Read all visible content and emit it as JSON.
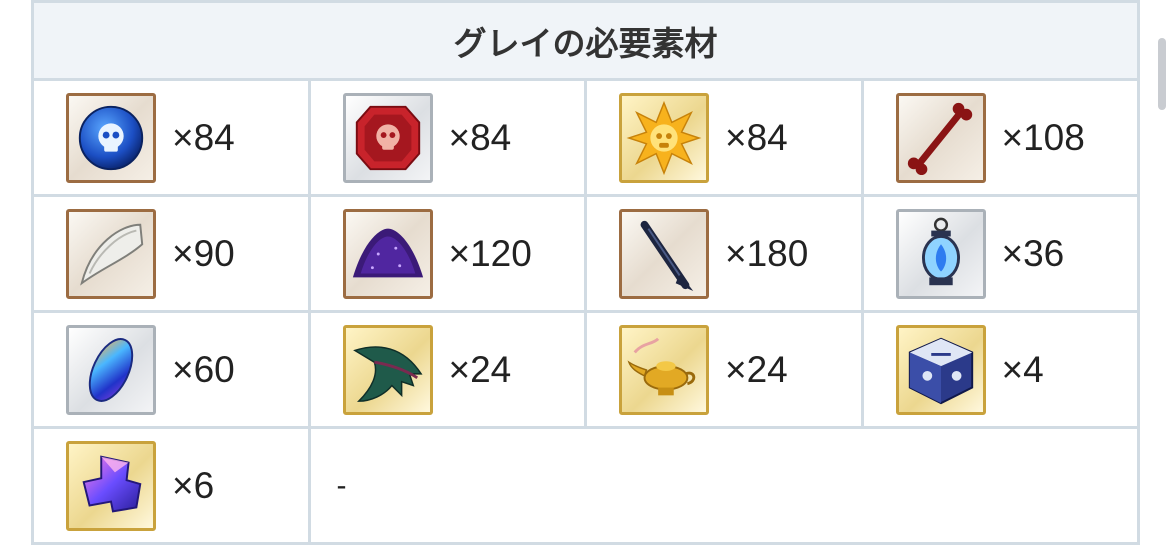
{
  "title": "グレイの必要素材",
  "materials": [
    {
      "icon": "blue-skull-orb-icon",
      "quantity": "×84"
    },
    {
      "icon": "red-skull-gem-icon",
      "quantity": "×84"
    },
    {
      "icon": "gold-skull-star-icon",
      "quantity": "×84"
    },
    {
      "icon": "red-bone-icon",
      "quantity": "×108"
    },
    {
      "icon": "white-fang-icon",
      "quantity": "×90"
    },
    {
      "icon": "purple-dust-pile-icon",
      "quantity": "×120"
    },
    {
      "icon": "dark-spike-icon",
      "quantity": "×180"
    },
    {
      "icon": "blue-flame-lantern-icon",
      "quantity": "×36"
    },
    {
      "icon": "rainbow-crystal-icon",
      "quantity": "×60"
    },
    {
      "icon": "green-wing-icon",
      "quantity": "×24"
    },
    {
      "icon": "golden-lamp-icon",
      "quantity": "×24"
    },
    {
      "icon": "ornate-cube-icon",
      "quantity": "×4"
    },
    {
      "icon": "purple-cube-shard-icon",
      "quantity": "×6"
    }
  ],
  "empty_cell": "-"
}
